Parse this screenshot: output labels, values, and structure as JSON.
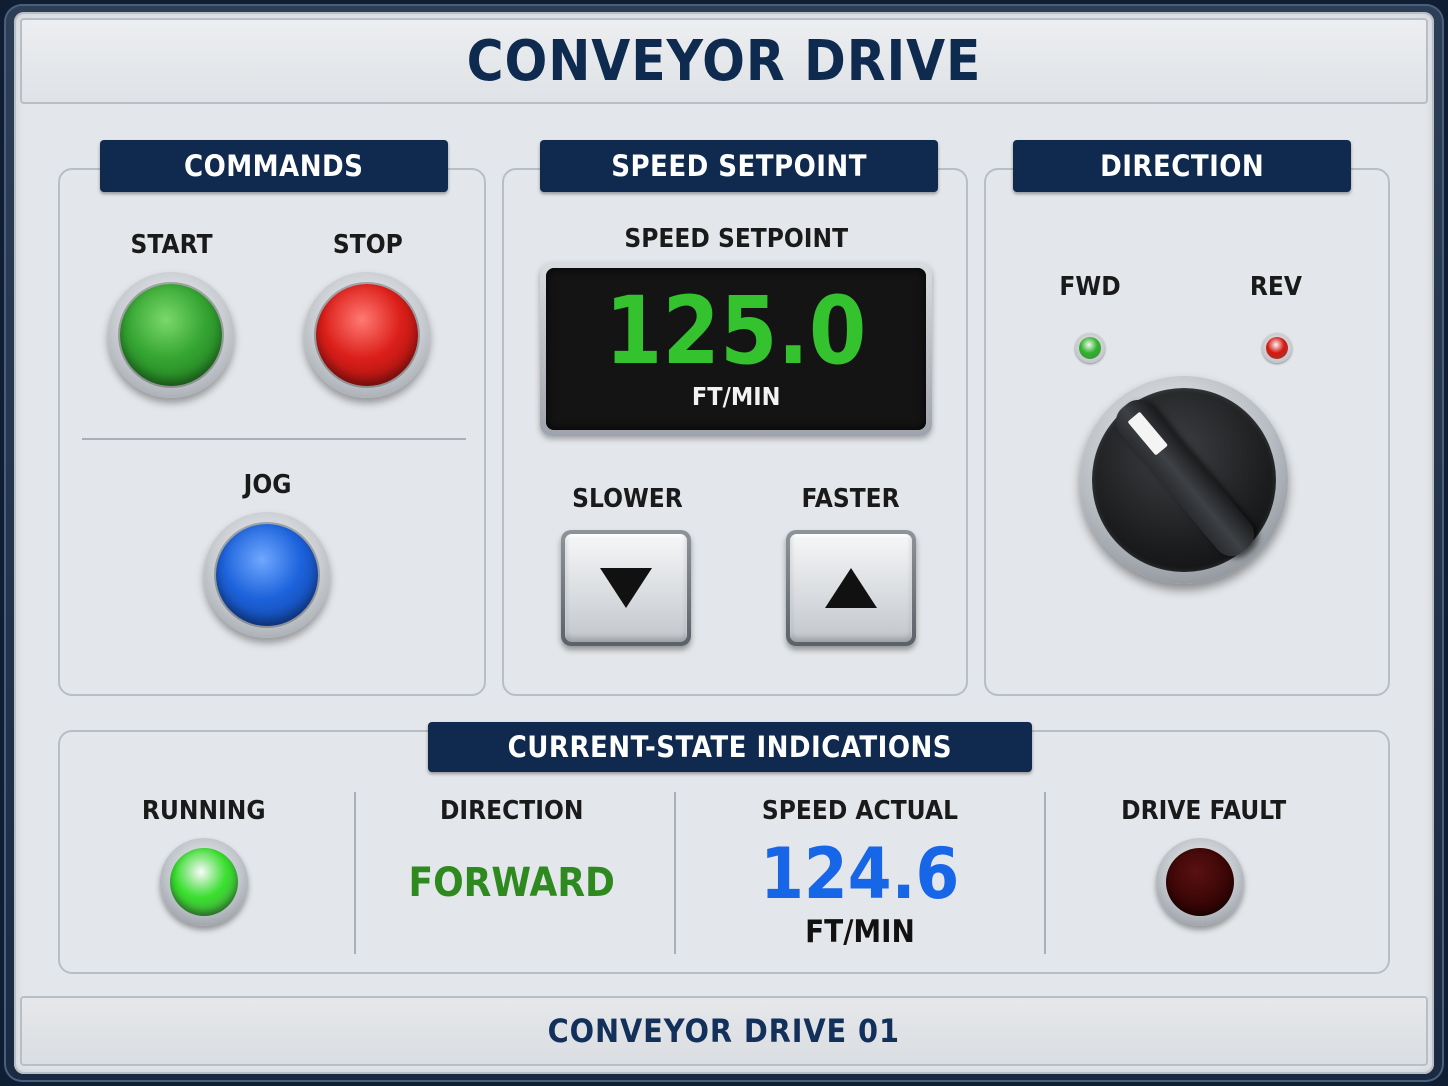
{
  "title": "CONVEYOR DRIVE",
  "footer": "CONVEYOR DRIVE 01",
  "commands": {
    "header": "COMMANDS",
    "start_label": "START",
    "stop_label": "STOP",
    "jog_label": "JOG"
  },
  "speed_setpoint": {
    "header": "SPEED SETPOINT",
    "display_label": "SPEED SETPOINT",
    "value": "125.0",
    "unit": "FT/MIN",
    "slower_label": "SLOWER",
    "faster_label": "FASTER",
    "slower_icon": "triangle-down-icon",
    "faster_icon": "triangle-up-icon"
  },
  "direction": {
    "header": "DIRECTION",
    "fwd_label": "FWD",
    "rev_label": "REV",
    "fwd_lamp_color": "#2fb52a",
    "rev_lamp_color": "#d8170f",
    "selector_position": "FWD"
  },
  "indications": {
    "header": "CURRENT-STATE INDICATIONS",
    "running_label": "RUNNING",
    "running_lamp_color": "#39e02e",
    "direction_label": "DIRECTION",
    "direction_value": "FORWARD",
    "direction_value_color": "#2e8a1f",
    "speed_actual_label": "SPEED ACTUAL",
    "speed_actual_value": "124.6",
    "speed_actual_unit": "FT/MIN",
    "speed_actual_color": "#1766e8",
    "drive_fault_label": "DRIVE FAULT",
    "drive_fault_lamp_color": "#3a0606"
  },
  "colors": {
    "header_bg": "#0f2a4e",
    "panel_bg": "#e3e6ea",
    "display_green": "#34c22e"
  }
}
